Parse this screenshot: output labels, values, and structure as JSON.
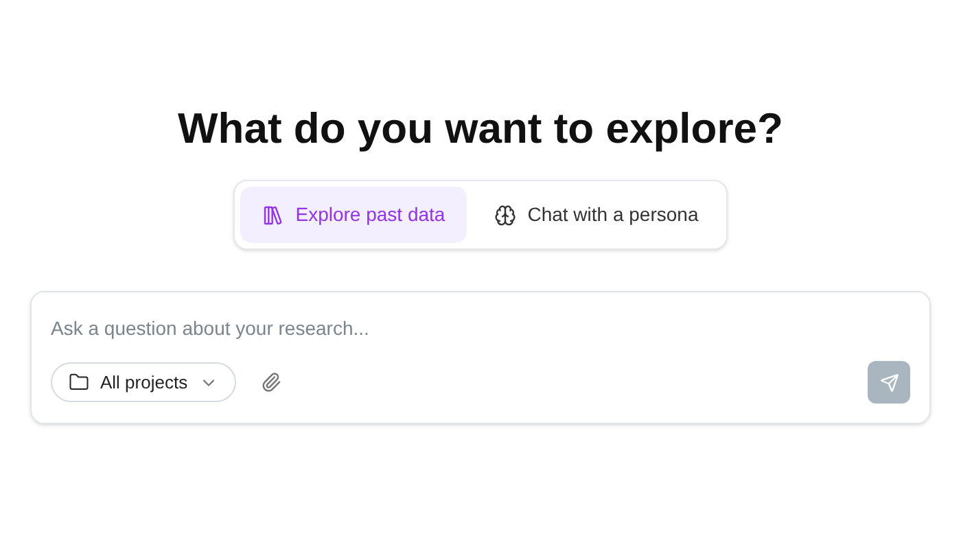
{
  "heading": "What do you want to explore?",
  "modes": [
    {
      "label": "Explore past data",
      "selected": true
    },
    {
      "label": "Chat with a persona",
      "selected": false
    }
  ],
  "query": {
    "placeholder": "Ask a question about your research..."
  },
  "project_filter": {
    "label": "All projects"
  },
  "send_button": {
    "disabled": true
  }
}
